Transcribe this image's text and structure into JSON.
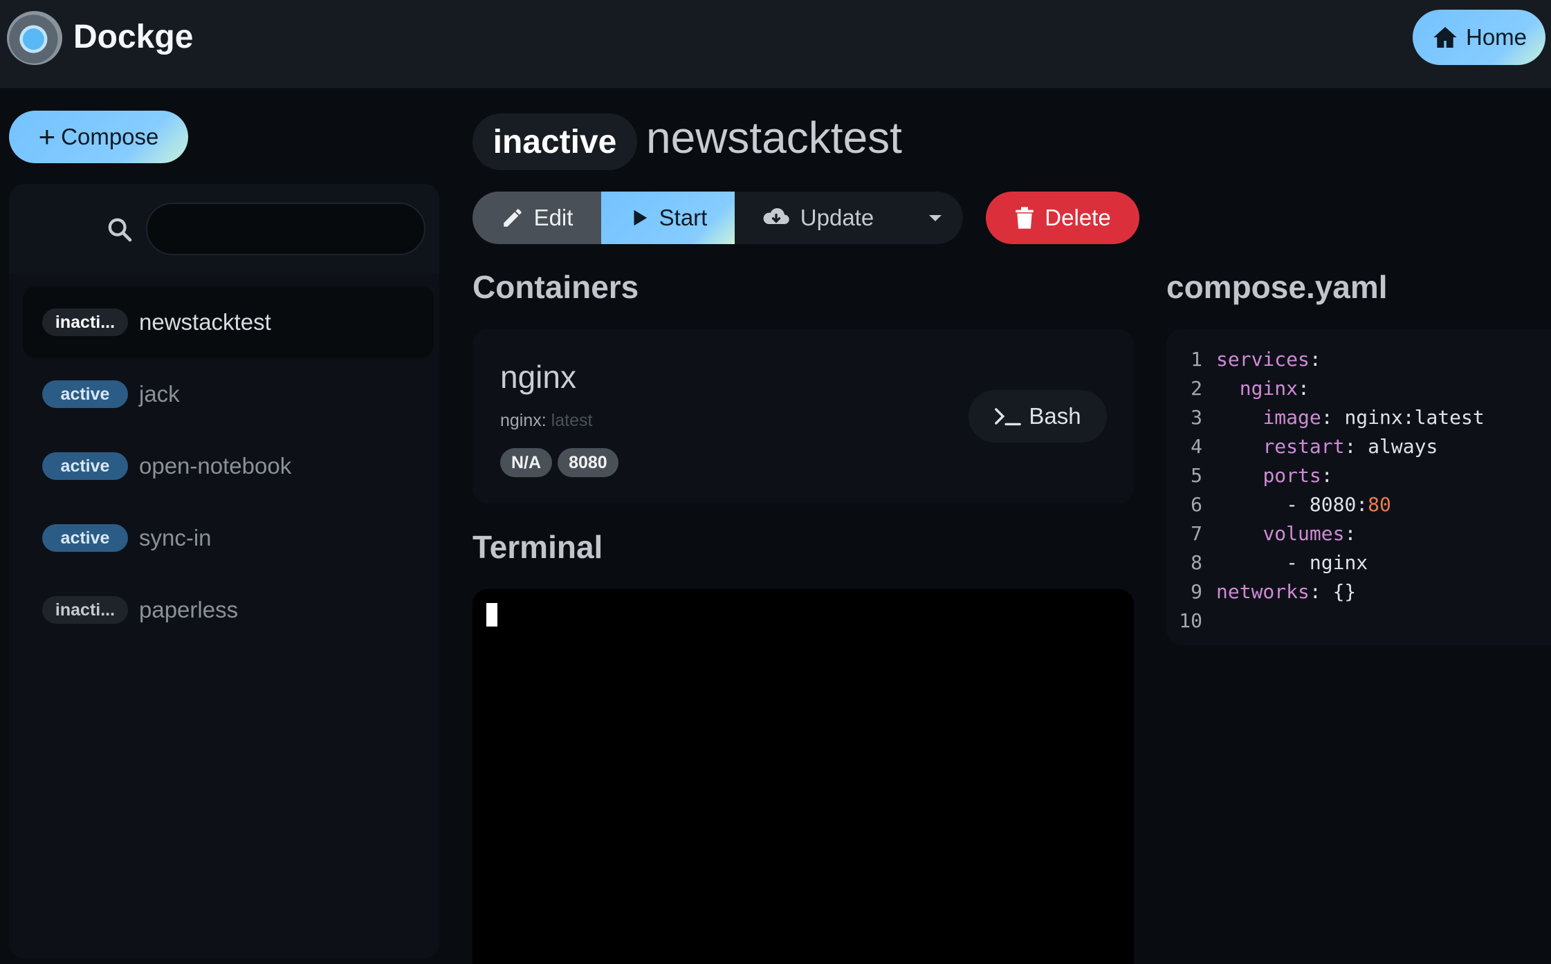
{
  "app": {
    "title": "Dockge",
    "home_label": "Home"
  },
  "sidebar": {
    "compose_label": "Compose",
    "search": {
      "value": "",
      "placeholder": ""
    },
    "stacks": [
      {
        "badge": "inacti...",
        "name": "newstacktest",
        "status": "inactive",
        "selected": true
      },
      {
        "badge": "active",
        "name": "jack",
        "status": "active"
      },
      {
        "badge": "active",
        "name": "open-notebook",
        "status": "active"
      },
      {
        "badge": "active",
        "name": "sync-in",
        "status": "active"
      },
      {
        "badge": "inacti...",
        "name": "paperless",
        "status": "inactive"
      }
    ]
  },
  "stack": {
    "status": "inactive",
    "name": "newstacktest",
    "toolbar": {
      "edit": "Edit",
      "start": "Start",
      "update": "Update",
      "delete": "Delete"
    }
  },
  "containers": {
    "title": "Containers",
    "items": [
      {
        "name": "nginx",
        "image_name": "nginx:",
        "image_tag": " latest",
        "ports": [
          "N/A",
          "8080"
        ],
        "bash_label": "Bash"
      }
    ]
  },
  "terminal": {
    "title": "Terminal"
  },
  "compose_file": {
    "title": "compose.yaml",
    "lines": [
      {
        "n": "1",
        "indent": "",
        "key": "services",
        "rest": ""
      },
      {
        "n": "2",
        "indent": "  ",
        "key": "nginx",
        "rest": ""
      },
      {
        "n": "3",
        "indent": "    ",
        "key": "image",
        "rest": " nginx:latest"
      },
      {
        "n": "4",
        "indent": "    ",
        "key": "restart",
        "rest": " always"
      },
      {
        "n": "5",
        "indent": "    ",
        "key": "ports",
        "rest": ""
      },
      {
        "n": "6",
        "indent": "      ",
        "key": "",
        "rest": "- 8080:",
        "num": "80"
      },
      {
        "n": "7",
        "indent": "    ",
        "key": "volumes",
        "rest": ""
      },
      {
        "n": "8",
        "indent": "      ",
        "key": "",
        "rest": "- nginx"
      },
      {
        "n": "9",
        "indent": "",
        "key": "networks",
        "rest": " {}"
      },
      {
        "n": "10",
        "indent": "",
        "key": "",
        "rest": ""
      }
    ]
  },
  "colors": {
    "accent": "#74c2ff",
    "danger": "#dc2f3c",
    "active_badge": "#2b5c86",
    "yaml_key": "#d08ad6",
    "yaml_number": "#ef7a4f"
  },
  "icons": [
    "home-icon",
    "plus-icon",
    "search-icon",
    "pencil-icon",
    "play-icon",
    "cloud-download-icon",
    "caret-down-icon",
    "trash-icon",
    "terminal-icon"
  ]
}
